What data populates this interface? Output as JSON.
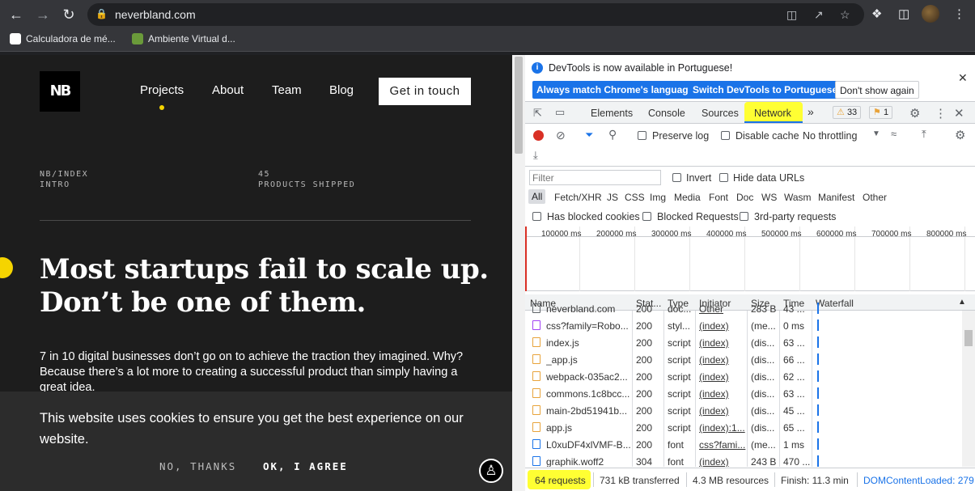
{
  "browser": {
    "url": "neverbland.com",
    "bookmarks": [
      {
        "label": "Calculadora de mé..."
      },
      {
        "label": "Ambiente Virtual d..."
      }
    ]
  },
  "site": {
    "logo": "NB",
    "nav": [
      "Projects",
      "About",
      "Team",
      "Blog"
    ],
    "cta": "Get in touch",
    "meta_left": [
      "NB/INDEX",
      "INTRO"
    ],
    "meta_right": [
      "45",
      "PRODUCTS SHIPPED"
    ],
    "headline": [
      "Most startups fail to scale up.",
      "Don’t be one of them."
    ],
    "lede": "7 in 10 digital businesses don’t go on to achieve the traction they imagined. Why? Because there’s a lot more to creating a successful product than simply having a great idea.",
    "cookie_text": "This website uses cookies to ensure you get the best experience on our website.",
    "cookie_decline": "NO, THANKS",
    "cookie_accept": "OK, I AGREE",
    "accent_color": "#f5d400"
  },
  "devtools": {
    "info_text": "DevTools is now available in Portuguese!",
    "info_buttons": [
      "Always match Chrome's language",
      "Switch DevTools to Portuguese",
      "Don't show again"
    ],
    "tabs": [
      "Elements",
      "Console",
      "Sources",
      "Network"
    ],
    "warnings": "33",
    "errors": "1",
    "preserve_log": "Preserve log",
    "disable_cache": "Disable cache",
    "throttling": "No throttling",
    "filter_placeholder": "Filter",
    "invert": "Invert",
    "hide_data_urls": "Hide data URLs",
    "types": [
      "All",
      "Fetch/XHR",
      "JS",
      "CSS",
      "Img",
      "Media",
      "Font",
      "Doc",
      "WS",
      "Wasm",
      "Manifest",
      "Other"
    ],
    "blocked_cookies": "Has blocked cookies",
    "blocked_requests": "Blocked Requests",
    "third_party": "3rd-party requests",
    "ticks": [
      "100000 ms",
      "200000 ms",
      "300000 ms",
      "400000 ms",
      "500000 ms",
      "600000 ms",
      "700000 ms",
      "800000 ms"
    ],
    "columns": [
      "Name",
      "Stat...",
      "Type",
      "Initiator",
      "Size",
      "Time",
      "Waterfall"
    ],
    "rows": [
      {
        "name": "neverbland.com",
        "status": "200",
        "type": "doc...",
        "initiator": "Other",
        "size": "283 B",
        "time": "43 ..."
      },
      {
        "name": "css?family=Robo...",
        "status": "200",
        "type": "styl...",
        "initiator": "(index)",
        "size": "(me...",
        "time": "0 ms"
      },
      {
        "name": "index.js",
        "status": "200",
        "type": "script",
        "initiator": "(index)",
        "size": "(dis...",
        "time": "63 ..."
      },
      {
        "name": "_app.js",
        "status": "200",
        "type": "script",
        "initiator": "(index)",
        "size": "(dis...",
        "time": "66 ..."
      },
      {
        "name": "webpack-035ac2...",
        "status": "200",
        "type": "script",
        "initiator": "(index)",
        "size": "(dis...",
        "time": "62 ..."
      },
      {
        "name": "commons.1c8bcc...",
        "status": "200",
        "type": "script",
        "initiator": "(index)",
        "size": "(dis...",
        "time": "63 ..."
      },
      {
        "name": "main-2bd51941b...",
        "status": "200",
        "type": "script",
        "initiator": "(index)",
        "size": "(dis...",
        "time": "45 ..."
      },
      {
        "name": "app.js",
        "status": "200",
        "type": "script",
        "initiator": "(index):1...",
        "size": "(dis...",
        "time": "65 ..."
      },
      {
        "name": "L0xuDF4xlVMF-B...",
        "status": "200",
        "type": "font",
        "initiator": "css?fami...",
        "size": "(me...",
        "time": "1 ms"
      },
      {
        "name": "graphik.woff2",
        "status": "304",
        "type": "font",
        "initiator": "(index)",
        "size": "243 B",
        "time": "470 ..."
      }
    ],
    "status": {
      "requests": "64 requests",
      "transferred": "731 kB transferred",
      "resources": "4.3 MB resources",
      "finish": "Finish: 11.3 min",
      "dcl": "DOMContentLoaded: 279"
    },
    "highlight_color": "#ffff33"
  }
}
